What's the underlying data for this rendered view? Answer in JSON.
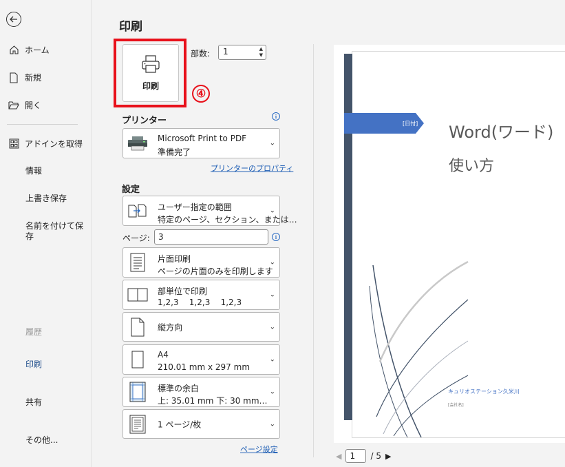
{
  "nav": {
    "home": "ホーム",
    "new": "新規",
    "open": "開く",
    "addins": "アドインを取得",
    "info": "情報",
    "save": "上書き保存",
    "save_as": "名前を付けて保存",
    "history": "履歴",
    "print": "印刷",
    "share": "共有",
    "more": "その他..."
  },
  "print": {
    "title": "印刷",
    "button_label": "印刷",
    "step_marker": "④",
    "copies_label": "部数:",
    "copies_value": "1"
  },
  "printer": {
    "heading": "プリンター",
    "name": "Microsoft Print to PDF",
    "status": "準備完了",
    "properties_link": "プリンターのプロパティ"
  },
  "settings": {
    "heading": "設定",
    "range_title": "ユーザー指定の範囲",
    "range_desc": "特定のページ、セクション、または…",
    "pages_label": "ページ:",
    "pages_value": "3",
    "sides_title": "片面印刷",
    "sides_desc": "ページの片面のみを印刷します",
    "collate_title": "部単位で印刷",
    "collate_desc": "1,2,3    1,2,3    1,2,3",
    "orientation": "縦方向",
    "paper_title": "A4",
    "paper_desc": "210.01 mm x 297 mm",
    "margins_title": "標準の余白",
    "margins_desc": "上: 35.01 mm 下: 30 mm…",
    "per_sheet": "1 ページ/枚",
    "page_setup_link": "ページ設定"
  },
  "preview": {
    "date_placeholder": "[日付]",
    "doc_title": "Word(ワード)",
    "doc_subtitle": "使い方",
    "company_name": "キュリオステーション久米川",
    "company_placeholder": "[会社名]",
    "current_page": "1",
    "total_pages": "/ 5"
  },
  "colors": {
    "highlight": "#e8101a",
    "banner": "#4472c4",
    "sidebar_bar": "#44546a",
    "link": "#1f5fb5"
  }
}
